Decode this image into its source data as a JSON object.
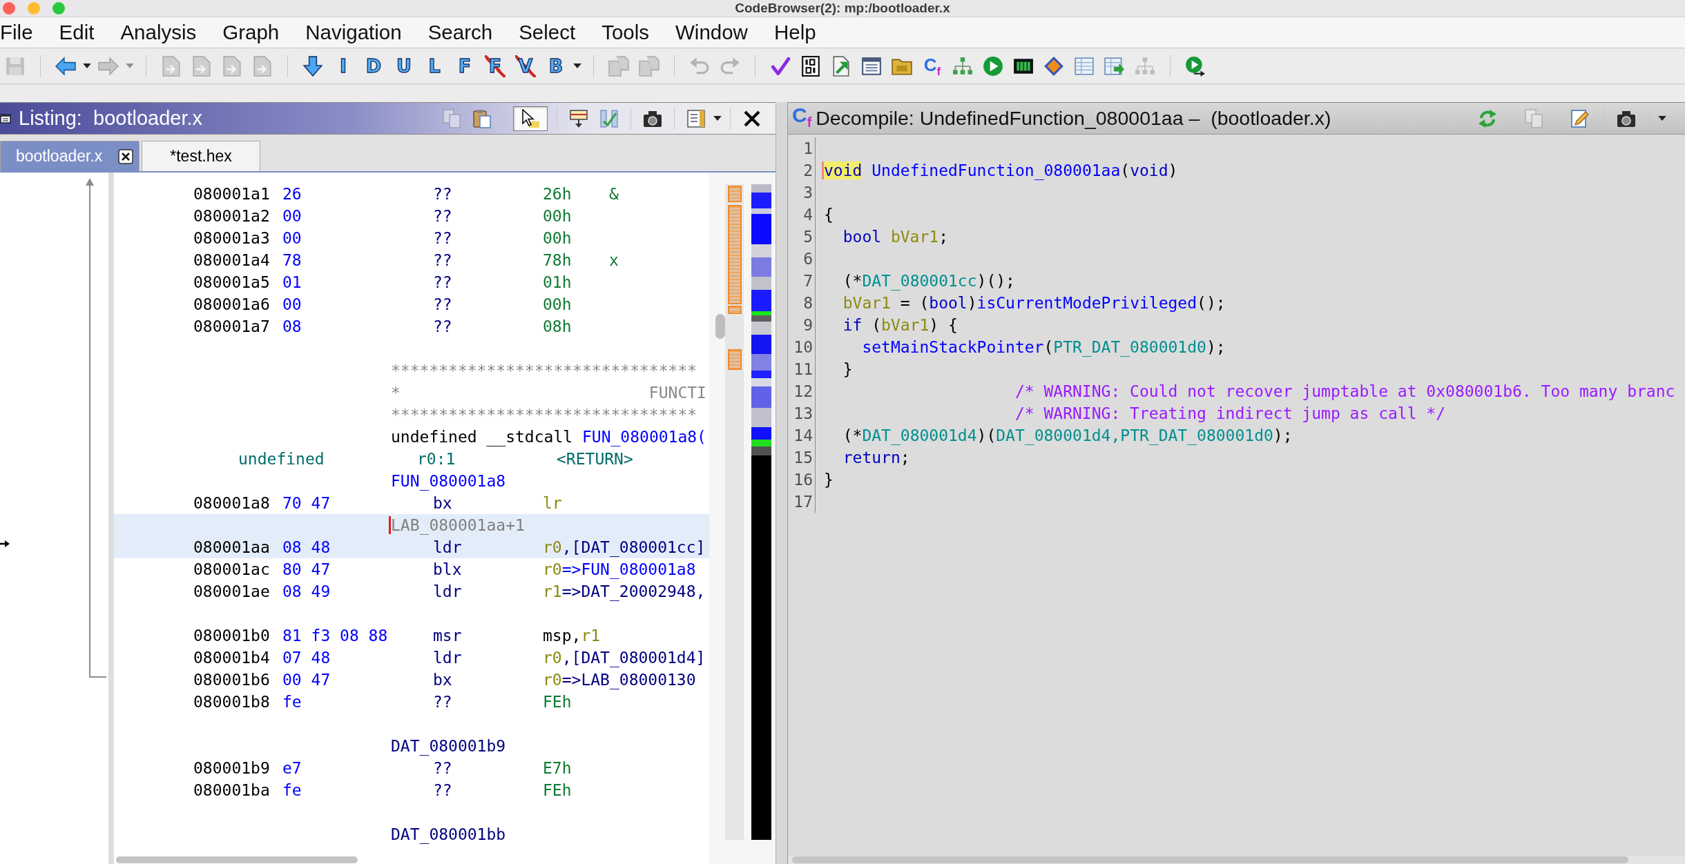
{
  "window": {
    "title": "CodeBrowser(2): mp:/bootloader.x"
  },
  "menu": [
    "File",
    "Edit",
    "Analysis",
    "Graph",
    "Navigation",
    "Search",
    "Select",
    "Tools",
    "Window",
    "Help"
  ],
  "toolbar": [
    {
      "items": [
        {
          "kind": "save",
          "disabled": true
        }
      ]
    },
    {
      "items": [
        {
          "kind": "back",
          "disabled": false
        },
        {
          "kind": "dropdown",
          "disabled": false
        },
        {
          "kind": "forward",
          "disabled": true
        },
        {
          "kind": "dropdown",
          "disabled": true
        }
      ]
    },
    {
      "items": [
        {
          "kind": "nav-page",
          "disabled": true
        },
        {
          "kind": "nav-page",
          "disabled": true
        },
        {
          "kind": "nav-page",
          "disabled": true
        },
        {
          "kind": "nav-page",
          "disabled": true
        }
      ]
    },
    {
      "items": [
        {
          "kind": "down-arrow",
          "disabled": false
        },
        {
          "kind": "letter",
          "label": "I",
          "disabled": false
        },
        {
          "kind": "letter",
          "label": "D",
          "disabled": false
        },
        {
          "kind": "letter",
          "label": "U",
          "disabled": false
        },
        {
          "kind": "letter",
          "label": "L",
          "disabled": false
        },
        {
          "kind": "letter",
          "label": "F",
          "disabled": false
        },
        {
          "kind": "letter-crossed",
          "label": "F",
          "disabled": false
        },
        {
          "kind": "letter-crossed",
          "label": "V",
          "disabled": false
        },
        {
          "kind": "letter",
          "label": "B",
          "disabled": false
        },
        {
          "kind": "dropdown",
          "disabled": false
        }
      ]
    },
    {
      "items": [
        {
          "kind": "page-pair",
          "disabled": true
        },
        {
          "kind": "page-pair",
          "disabled": true
        }
      ]
    },
    {
      "items": [
        {
          "kind": "undo",
          "disabled": true
        },
        {
          "kind": "redo",
          "disabled": true
        }
      ]
    },
    {
      "items": [
        {
          "kind": "check",
          "disabled": false
        },
        {
          "kind": "binary",
          "disabled": false
        },
        {
          "kind": "export",
          "disabled": false
        },
        {
          "kind": "window-list",
          "disabled": false
        },
        {
          "kind": "folder",
          "disabled": false
        },
        {
          "kind": "decompiler",
          "label": "C$_{f}$",
          "disabled": false
        },
        {
          "kind": "tree",
          "disabled": false
        },
        {
          "kind": "play",
          "disabled": false
        },
        {
          "kind": "chip",
          "disabled": false
        },
        {
          "kind": "diamond",
          "disabled": false
        },
        {
          "kind": "table",
          "disabled": false
        },
        {
          "kind": "table-export",
          "disabled": false
        },
        {
          "kind": "tree",
          "disabled": true
        }
      ]
    },
    {
      "items": [
        {
          "kind": "play-script",
          "disabled": false
        }
      ]
    }
  ],
  "listing": {
    "title": "Listing:  bootloader.x",
    "tools": [
      {
        "items": [
          {
            "kind": "copy",
            "disabled": true,
            "on": false
          },
          {
            "kind": "paste",
            "disabled": false,
            "on": false
          }
        ]
      },
      {
        "items": [
          {
            "kind": "pointer",
            "disabled": false,
            "on": true
          }
        ]
      },
      {
        "items": [
          {
            "kind": "field",
            "disabled": false,
            "on": false
          },
          {
            "kind": "diff",
            "disabled": false,
            "on": false
          }
        ]
      },
      {
        "items": [
          {
            "kind": "camera",
            "disabled": false,
            "on": false
          }
        ]
      },
      {
        "items": [
          {
            "kind": "columns",
            "disabled": false,
            "on": false
          },
          {
            "kind": "dropdown",
            "disabled": false,
            "on": false
          }
        ]
      },
      {
        "items": [
          {
            "kind": "close",
            "disabled": false,
            "on": false
          }
        ]
      }
    ],
    "tabs": [
      {
        "label": "bootloader.x",
        "selected": true
      },
      {
        "label": "*test.hex",
        "selected": false
      }
    ],
    "blocks": [
      {
        "rows": [
          {
            "kind": "code",
            "address": "080001a1",
            "bytes": "26",
            "mnemonic": "??",
            "operands": [
              {
                "text": "26h",
                "kind": "scalar"
              }
            ],
            "comment": "&",
            "selected": false,
            "cursor": false
          },
          {
            "kind": "code",
            "address": "080001a2",
            "bytes": "00",
            "mnemonic": "??",
            "operands": [
              {
                "text": "00h",
                "kind": "scalar"
              }
            ],
            "selected": false,
            "cursor": false
          },
          {
            "kind": "code",
            "address": "080001a3",
            "bytes": "00",
            "mnemonic": "??",
            "operands": [
              {
                "text": "00h",
                "kind": "scalar"
              }
            ],
            "selected": false,
            "cursor": false
          },
          {
            "kind": "code",
            "address": "080001a4",
            "bytes": "78",
            "mnemonic": "??",
            "operands": [
              {
                "text": "78h",
                "kind": "scalar"
              }
            ],
            "comment": "x",
            "selected": false,
            "cursor": false
          },
          {
            "kind": "code",
            "address": "080001a5",
            "bytes": "01",
            "mnemonic": "??",
            "operands": [
              {
                "text": "01h",
                "kind": "scalar"
              }
            ],
            "selected": false,
            "cursor": false
          },
          {
            "kind": "code",
            "address": "080001a6",
            "bytes": "00",
            "mnemonic": "??",
            "operands": [
              {
                "text": "00h",
                "kind": "scalar"
              }
            ],
            "selected": false,
            "cursor": false
          },
          {
            "kind": "code",
            "address": "080001a7",
            "bytes": "08",
            "mnemonic": "??",
            "operands": [
              {
                "text": "08h",
                "kind": "scalar"
              }
            ],
            "selected": false,
            "cursor": false
          }
        ]
      },
      {
        "rows": [
          {
            "kind": "banner",
            "text": "********************************",
            "selected": false,
            "cursor": false
          },
          {
            "kind": "banner-title",
            "text": "*",
            "title": "FUNCTI",
            "selected": false,
            "cursor": false
          },
          {
            "kind": "banner",
            "text": "********************************",
            "selected": false,
            "cursor": false
          },
          {
            "kind": "signature",
            "tokens": [
              {
                "text": "undefined __stdcall ",
                "kind": "plain"
              },
              {
                "text": "FUN_080001a8(",
                "kind": "func"
              }
            ],
            "selected": false,
            "cursor": false
          },
          {
            "kind": "return",
            "type": "undefined",
            "storage": "r0:1",
            "name": "<RETURN>",
            "selected": false,
            "cursor": false
          },
          {
            "kind": "label",
            "label": {
              "text": "FUN_080001a8",
              "kind": "func"
            },
            "selected": false,
            "cursor": false
          },
          {
            "kind": "code",
            "address": "080001a8",
            "bytes": "70 47",
            "mnemonic": "bx",
            "operands": [
              {
                "text": "lr",
                "kind": "register"
              }
            ],
            "selected": false,
            "cursor": false
          },
          {
            "kind": "label",
            "label": {
              "text": "LAB_080001aa+1",
              "kind": "local"
            },
            "selected": true,
            "cursor": true
          },
          {
            "kind": "code",
            "address": "080001aa",
            "bytes": "08 48",
            "mnemonic": "ldr",
            "operands": [
              {
                "text": "r0",
                "kind": "register"
              },
              {
                "text": ",[DAT_080001cc]",
                "kind": "ref"
              }
            ],
            "selected": true,
            "cursor": false
          },
          {
            "kind": "code",
            "address": "080001ac",
            "bytes": "80 47",
            "mnemonic": "blx",
            "operands": [
              {
                "text": "r0",
                "kind": "register"
              },
              {
                "text": "=>FUN_080001a8",
                "kind": "func"
              }
            ],
            "selected": false,
            "cursor": false
          },
          {
            "kind": "code",
            "address": "080001ae",
            "bytes": "08 49",
            "mnemonic": "ldr",
            "operands": [
              {
                "text": "r1",
                "kind": "register"
              },
              {
                "text": "=>DAT_20002948,",
                "kind": "ref"
              }
            ],
            "selected": false,
            "cursor": false
          }
        ]
      },
      {
        "rows": [
          {
            "kind": "code",
            "address": "080001b0",
            "bytes": "81 f3 08 88",
            "mnemonic": "msr",
            "operands": [
              {
                "text": "msp,",
                "kind": "plain"
              },
              {
                "text": "r1",
                "kind": "register"
              }
            ],
            "selected": false,
            "cursor": false
          },
          {
            "kind": "code",
            "address": "080001b4",
            "bytes": "07 48",
            "mnemonic": "ldr",
            "operands": [
              {
                "text": "r0",
                "kind": "register"
              },
              {
                "text": ",[DAT_080001d4]",
                "kind": "ref"
              }
            ],
            "selected": false,
            "cursor": false
          },
          {
            "kind": "code",
            "address": "080001b6",
            "bytes": "00 47",
            "mnemonic": "bx",
            "operands": [
              {
                "text": "r0",
                "kind": "register"
              },
              {
                "text": "=>LAB_08000130",
                "kind": "ref"
              }
            ],
            "selected": false,
            "cursor": false
          },
          {
            "kind": "code",
            "address": "080001b8",
            "bytes": "fe",
            "mnemonic": "??",
            "operands": [
              {
                "text": "FEh",
                "kind": "scalar"
              }
            ],
            "selected": false,
            "cursor": false
          }
        ]
      },
      {
        "rows": [
          {
            "kind": "label",
            "label": {
              "text": "DAT_080001b9",
              "kind": "ref"
            },
            "selected": false,
            "cursor": false
          },
          {
            "kind": "code",
            "address": "080001b9",
            "bytes": "e7",
            "mnemonic": "??",
            "operands": [
              {
                "text": "E7h",
                "kind": "scalar"
              }
            ],
            "selected": false,
            "cursor": false
          },
          {
            "kind": "code",
            "address": "080001ba",
            "bytes": "fe",
            "mnemonic": "??",
            "operands": [
              {
                "text": "FEh",
                "kind": "scalar"
              }
            ],
            "selected": false,
            "cursor": false
          }
        ]
      },
      {
        "rows": [
          {
            "kind": "label",
            "label": {
              "text": "DAT_080001bb",
              "kind": "ref"
            },
            "selected": false,
            "cursor": false
          }
        ]
      }
    ]
  },
  "decompile": {
    "icon": "C$_{f}$",
    "title": "Decompile: UndefinedFunction_080001aa –  (bootloader.x)",
    "tools": [
      {
        "items": [
          {
            "kind": "refresh",
            "disabled": false
          }
        ]
      },
      {
        "items": [
          {
            "kind": "copy",
            "disabled": true
          }
        ]
      },
      {
        "items": [
          {
            "kind": "edit",
            "disabled": false
          }
        ]
      },
      {
        "items": [
          {
            "kind": "camera",
            "disabled": false
          }
        ]
      },
      {
        "items": [
          {
            "kind": "dropdown",
            "disabled": false
          }
        ]
      }
    ],
    "lines": [
      {
        "number": "1",
        "kind": "blank"
      },
      {
        "number": "2",
        "kind": "code",
        "tokens": [
          {
            "text": "void",
            "kind": "keyword",
            "highlighted": true
          },
          {
            "text": " UndefinedFunction_080001aa",
            "kind": "function",
            "highlighted": false
          },
          {
            "text": "(",
            "kind": "plain",
            "highlighted": false
          },
          {
            "text": "void",
            "kind": "keyword",
            "highlighted": false
          },
          {
            "text": ")",
            "kind": "plain",
            "highlighted": false
          }
        ]
      },
      {
        "number": "3",
        "kind": "blank"
      },
      {
        "number": "4",
        "kind": "code",
        "tokens": [
          {
            "text": "{",
            "kind": "plain",
            "highlighted": false
          }
        ],
        "children": [
          {
            "number": "5",
            "kind": "code",
            "tokens": [
              {
                "text": "bool",
                "kind": "keyword",
                "highlighted": false
              },
              {
                "text": " bVar1",
                "kind": "variable",
                "highlighted": false
              },
              {
                "text": ";",
                "kind": "plain",
                "highlighted": false
              }
            ]
          },
          {
            "number": "6",
            "kind": "blank"
          },
          {
            "number": "7",
            "kind": "code",
            "tokens": [
              {
                "text": "(*",
                "kind": "plain",
                "highlighted": false
              },
              {
                "text": "DAT_080001cc",
                "kind": "global",
                "highlighted": false
              },
              {
                "text": ")();",
                "kind": "plain",
                "highlighted": false
              }
            ]
          },
          {
            "number": "8",
            "kind": "code",
            "tokens": [
              {
                "text": "bVar1",
                "kind": "variable",
                "highlighted": false
              },
              {
                "text": " = (",
                "kind": "plain",
                "highlighted": false
              },
              {
                "text": "bool",
                "kind": "keyword",
                "highlighted": false
              },
              {
                "text": ")",
                "kind": "plain",
                "highlighted": false
              },
              {
                "text": "isCurrentModePrivileged",
                "kind": "function",
                "highlighted": false
              },
              {
                "text": "();",
                "kind": "plain",
                "highlighted": false
              }
            ]
          },
          {
            "number": "9",
            "kind": "code",
            "tokens": [
              {
                "text": "if",
                "kind": "keyword",
                "highlighted": false
              },
              {
                "text": " (",
                "kind": "plain",
                "highlighted": false
              },
              {
                "text": "bVar1",
                "kind": "variable",
                "highlighted": false
              },
              {
                "text": ") {",
                "kind": "plain",
                "highlighted": false
              }
            ],
            "children": [
              {
                "number": "10",
                "kind": "code",
                "tokens": [
                  {
                    "text": "setMainStackPointer",
                    "kind": "function",
                    "highlighted": false
                  },
                  {
                    "text": "(",
                    "kind": "plain",
                    "highlighted": false
                  },
                  {
                    "text": "PTR_DAT_080001d0",
                    "kind": "global",
                    "highlighted": false
                  },
                  {
                    "text": ");",
                    "kind": "plain",
                    "highlighted": false
                  }
                ]
              }
            ]
          },
          {
            "number": "11",
            "kind": "code",
            "tokens": [
              {
                "text": "}",
                "kind": "plain",
                "highlighted": false
              }
            ]
          },
          {
            "number": "12",
            "kind": "comment",
            "tokens": [
              {
                "text": "/* WARNING: Could not recover jumptable at 0x080001b6. Too many branc",
                "kind": "comment",
                "highlighted": false
              }
            ]
          },
          {
            "number": "13",
            "kind": "comment",
            "tokens": [
              {
                "text": "/* WARNING: Treating indirect jump as call */",
                "kind": "comment",
                "highlighted": false
              }
            ]
          },
          {
            "number": "14",
            "kind": "code",
            "tokens": [
              {
                "text": "(*",
                "kind": "plain",
                "highlighted": false
              },
              {
                "text": "DAT_080001d4",
                "kind": "global",
                "highlighted": false
              },
              {
                "text": ")(",
                "kind": "plain",
                "highlighted": false
              },
              {
                "text": "DAT_080001d4,",
                "kind": "global",
                "highlighted": false
              },
              {
                "text": "PTR_DAT_080001d0",
                "kind": "global",
                "highlighted": false
              },
              {
                "text": ");",
                "kind": "plain",
                "highlighted": false
              }
            ]
          },
          {
            "number": "15",
            "kind": "code",
            "tokens": [
              {
                "text": "return",
                "kind": "keyword",
                "highlighted": false
              },
              {
                "text": ";",
                "kind": "plain",
                "highlighted": false
              }
            ]
          }
        ]
      },
      {
        "number": "16",
        "kind": "code",
        "tokens": [
          {
            "text": "}",
            "kind": "plain",
            "highlighted": false
          }
        ]
      },
      {
        "number": "17",
        "kind": "blank"
      }
    ]
  }
}
